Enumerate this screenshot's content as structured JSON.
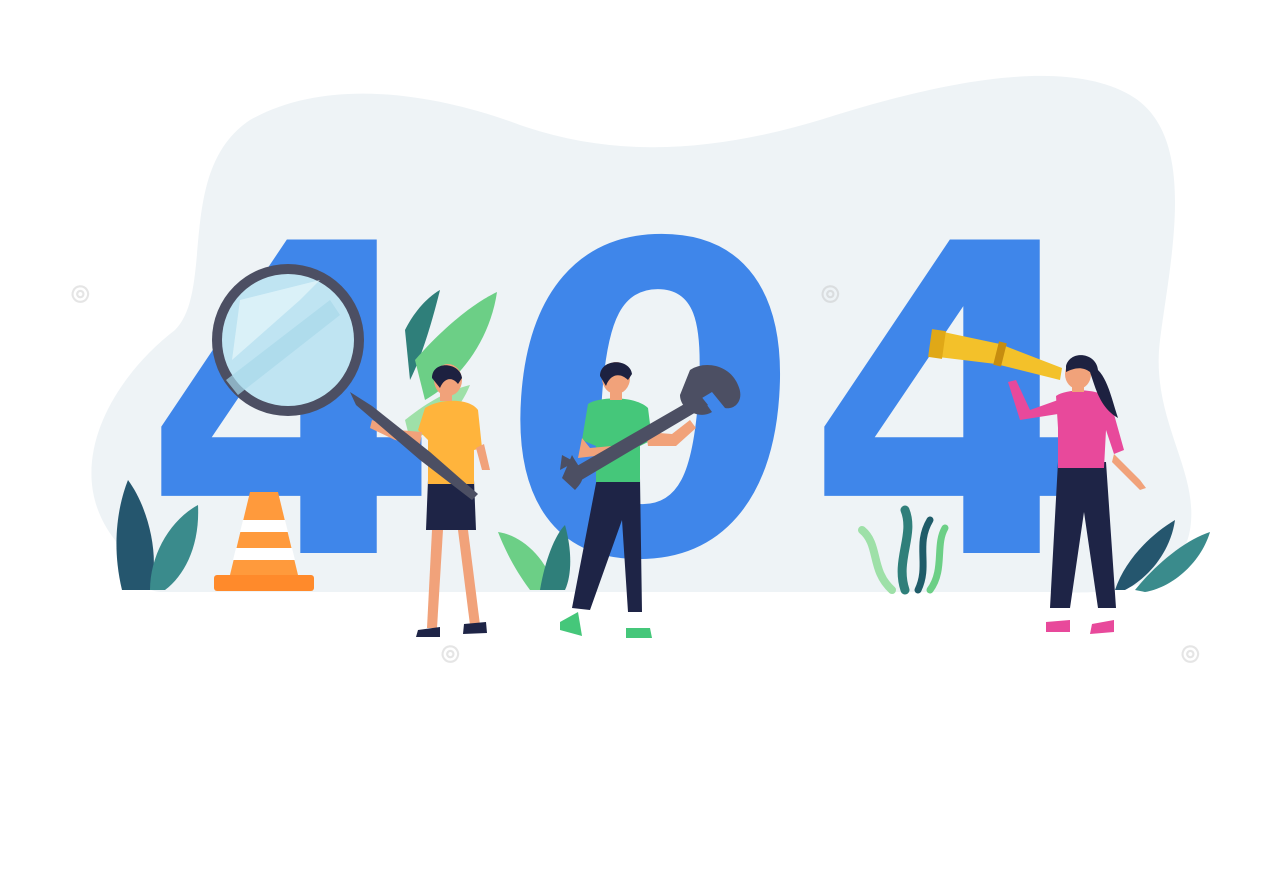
{
  "illustration": {
    "digits": [
      "4",
      "0",
      "4"
    ],
    "colors": {
      "digit_blue": "#3f86ea",
      "blob_background": "#eef3f6",
      "leaf_dark": "#25566e",
      "leaf_green": "#5bc07a",
      "leaf_light": "#9ee0a8",
      "cone_orange": "#ff8a2b",
      "shirt_orange": "#ffb43c",
      "shirt_green": "#45c77a",
      "shirt_pink": "#e8499b",
      "pants_navy": "#1e2446",
      "skin": "#f1a27a",
      "hair": "#1d2140",
      "tool_gray": "#4c4f63",
      "spyglass_gold": "#f3c12a"
    },
    "icons": [
      "magnifying-glass-icon",
      "wrench-icon",
      "spyglass-icon",
      "traffic-cone-icon"
    ]
  }
}
